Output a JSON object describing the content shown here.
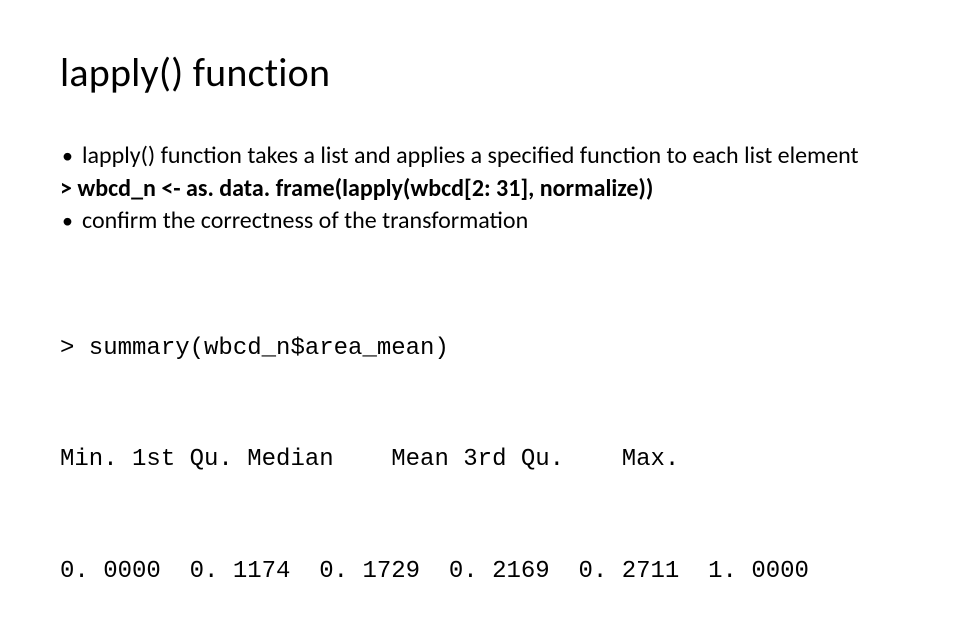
{
  "title": "lapply() function",
  "bullets": {
    "b1": "lapply() function takes a list and applies a specified function to each list element",
    "code1": "> wbcd_n <- as. data. frame(lapply(wbcd[2: 31], normalize))",
    "b2": "confirm the correctness of the transformation"
  },
  "mono": {
    "l1": "> summary(wbcd_n$area_mean)",
    "l2": "Min. 1st Qu. Median    Mean 3rd Qu.    Max.",
    "l3": "0. 0000  0. 1174  0. 1729  0. 2169  0. 2711  1. 0000"
  }
}
